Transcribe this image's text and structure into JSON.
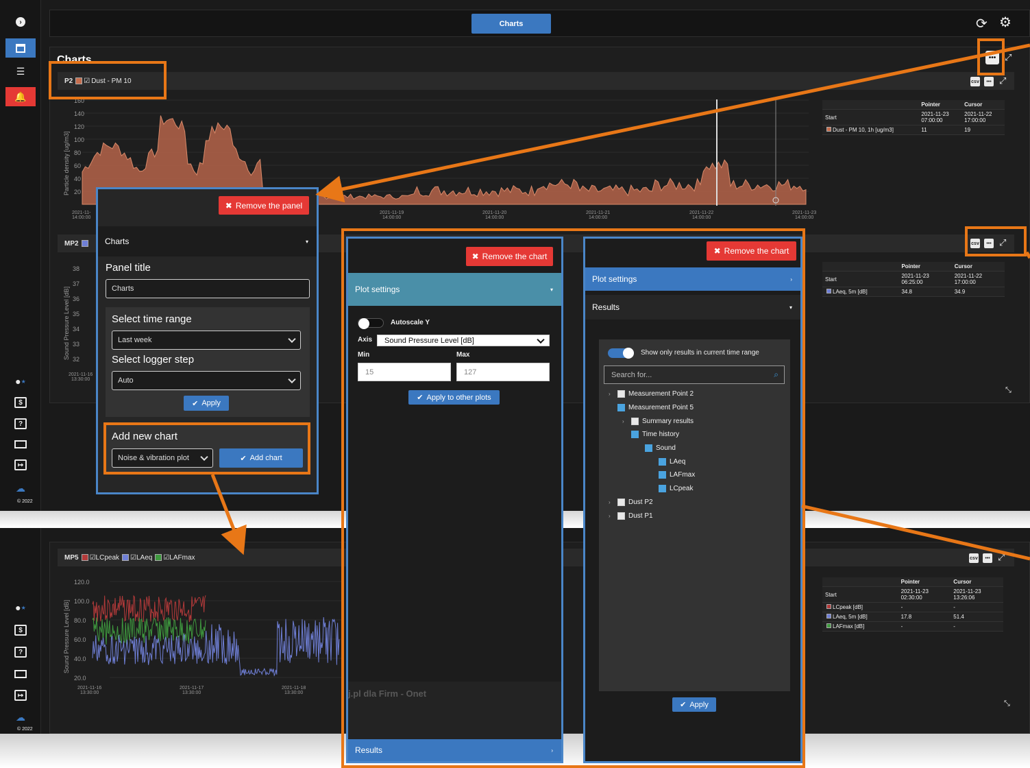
{
  "topbar": {
    "charts_button": "Charts"
  },
  "panel": {
    "title": "Charts"
  },
  "chart1": {
    "point": "P2",
    "series_label": "Dust - PM 10",
    "ylabel": "Particle density [ug/m3]",
    "yticks": [
      "160",
      "140",
      "120",
      "100",
      "80",
      "60",
      "40",
      "20"
    ],
    "xticks": [
      {
        "date": "2021-11-",
        "time": "14:00:00"
      },
      {
        "date": "2021-11-19",
        "time": "14:00:00"
      },
      {
        "date": "2021-11-20",
        "time": "14:00:00"
      },
      {
        "date": "2021-11-21",
        "time": "14:00:00"
      },
      {
        "date": "2021-11-22",
        "time": "14:00:00"
      },
      {
        "date": "2021-11-23",
        "time": "14:00:00"
      }
    ],
    "legend": {
      "col_pointer": "Pointer",
      "col_cursor": "Cursor",
      "row_start": "Start",
      "pointer_date": "2021-11-23",
      "pointer_time": "07:00:00",
      "cursor_date": "2021-11-22",
      "cursor_time": "17:00:00",
      "series": "Dust - PM 10, 1h [ug/m3]",
      "pointer_val": "11",
      "cursor_val": "19"
    },
    "color": "#c76e4e"
  },
  "chart2": {
    "point": "MP2",
    "ylabel": "Sound Pressure Level [dB]",
    "yticks": [
      "38",
      "37",
      "36",
      "35",
      "34",
      "33",
      "32"
    ],
    "xtick": {
      "date": "2021-11-16",
      "time": "13:30:00"
    },
    "legend": {
      "col_pointer": "Pointer",
      "col_cursor": "Cursor",
      "row_start": "Start",
      "pointer_date": "2021-11-23",
      "pointer_time": "06:25:00",
      "cursor_date": "2021-11-22",
      "cursor_time": "17:00:00",
      "series": "LAeq, 5m [dB]",
      "pointer_val": "34.8",
      "cursor_val": "34.9"
    }
  },
  "chart3": {
    "point": "MP5",
    "s1": "LCpeak",
    "s2": "LAeq",
    "s3": "LAFmax",
    "ylabel": "Sound Pressure Level [dB]",
    "yticks": [
      "120.0",
      "100.0",
      "80.0",
      "60.0",
      "40.0",
      "20.0"
    ],
    "xticks": [
      {
        "date": "2021-11-16",
        "time": "13:30:00"
      },
      {
        "date": "2021-11-17",
        "time": "13:30:00"
      },
      {
        "date": "2021-11-18",
        "time": "13:30:00"
      }
    ],
    "legend": {
      "col_pointer": "Pointer",
      "col_cursor": "Cursor",
      "row_start": "Start",
      "pointer_date": "2021-11-23",
      "pointer_time": "02:30:00",
      "cursor_date": "2021-11-23",
      "cursor_time": "13:26:06",
      "r1": "LCpeak [dB]",
      "r1p": "-",
      "r1c": "-",
      "r2": "LAeq, 5m [dB]",
      "r2p": "17.8",
      "r2c": "51.4",
      "r3": "LAFmax [dB]",
      "r3p": "-",
      "r3c": "-"
    }
  },
  "panel_settings": {
    "remove_panel": "Remove the panel",
    "section": "Charts",
    "panel_title_label": "Panel title",
    "panel_title_value": "Charts",
    "time_range_label": "Select time range",
    "time_range_value": "Last week",
    "logger_step_label": "Select logger step",
    "logger_step_value": "Auto",
    "apply": "Apply",
    "add_chart_label": "Add new chart",
    "chart_type_value": "Noise & vibration plot",
    "add_chart": "Add chart"
  },
  "plot_settings": {
    "remove_chart": "Remove the chart",
    "section": "Plot settings",
    "autoscale": "Autoscale Y",
    "axis_label": "Axis",
    "axis_value": "Sound Pressure Level [dB]",
    "min_label": "Min",
    "max_label": "Max",
    "min_value": "15",
    "max_value": "127",
    "apply_other": "Apply to other plots",
    "results": "Results",
    "ghost_title": "j.pl dla Firm - Onet"
  },
  "results_settings": {
    "remove_chart": "Remove the chart",
    "plot_settings": "Plot settings",
    "results": "Results",
    "toggle_label": "Show only results in current time range",
    "search_placeholder": "Search for...",
    "tree": [
      "Measurement Point 2",
      "Measurement Point 5",
      "Summary results",
      "Time history",
      "Sound",
      "LAeq",
      "LAFmax",
      "LCpeak",
      "Dust P2",
      "Dust P1"
    ],
    "apply": "Apply"
  },
  "sidebar": {
    "copyright": "© 2022"
  },
  "colors": {
    "accent": "#3b78c0",
    "danger": "#e53935",
    "highlight": "#e87717",
    "lcpeak": "#b33a3a",
    "laeq": "#6f7fd6",
    "lafmax": "#3f9a3f"
  }
}
